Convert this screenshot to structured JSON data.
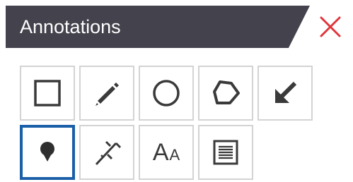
{
  "panel": {
    "title": "Annotations",
    "close_icon": "close-x-icon",
    "accent_color": "#1a5fa8",
    "header_color": "#44424c",
    "close_color": "#e0353b"
  },
  "tools": [
    {
      "name": "rectangle",
      "icon": "square-outline-icon",
      "active": false
    },
    {
      "name": "pen",
      "icon": "pencil-icon",
      "active": false
    },
    {
      "name": "ellipse",
      "icon": "circle-outline-icon",
      "active": false
    },
    {
      "name": "polygon",
      "icon": "polygon-outline-icon",
      "active": false
    },
    {
      "name": "arrow",
      "icon": "arrow-down-left-icon",
      "active": false
    },
    {
      "name": "pin",
      "icon": "map-pin-icon",
      "active": true
    },
    {
      "name": "measure",
      "icon": "caliper-icon",
      "active": false
    },
    {
      "name": "text",
      "icon": "text-size-icon",
      "active": false,
      "glyph_big": "A",
      "glyph_small": "A"
    },
    {
      "name": "note",
      "icon": "note-lines-icon",
      "active": false
    }
  ]
}
